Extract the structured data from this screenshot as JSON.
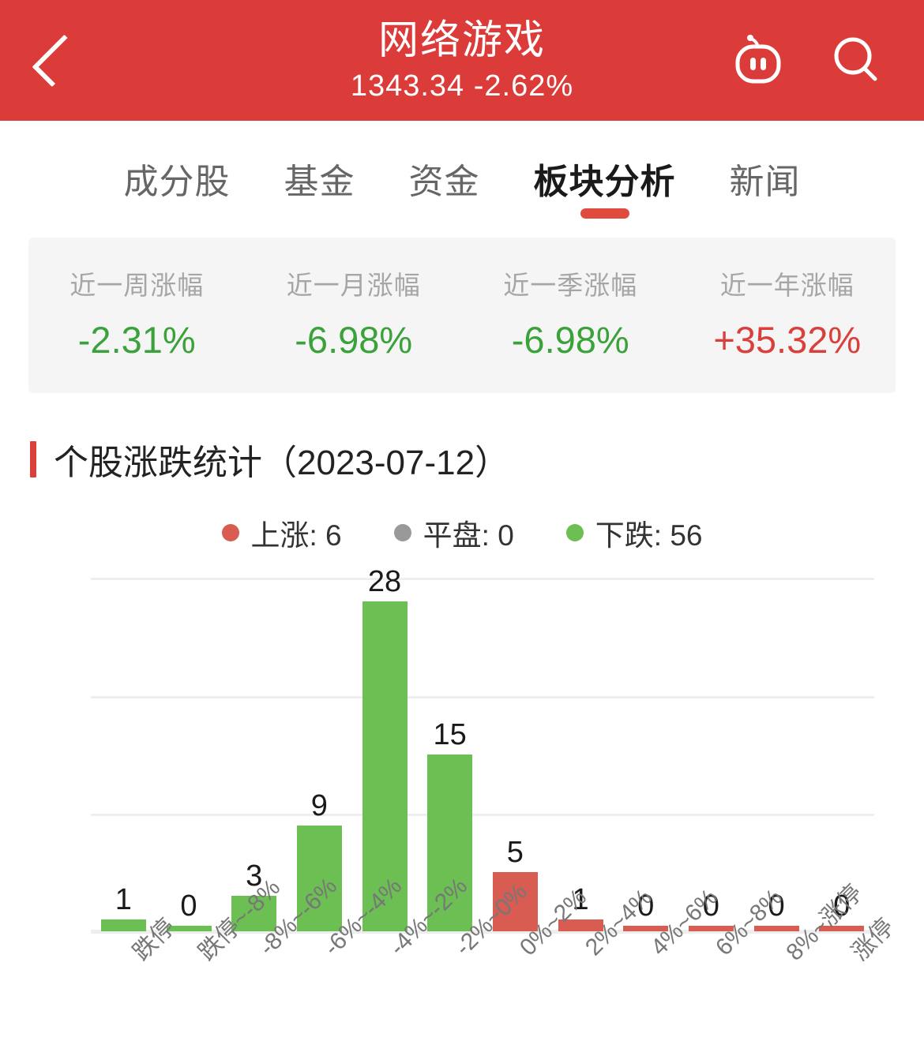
{
  "header": {
    "back_icon": "chevron-left-icon",
    "title": "网络游戏",
    "subtitle": "1343.34 -2.62%",
    "robot_icon": "robot-icon",
    "search_icon": "search-icon",
    "bg_color": "#dc3c39"
  },
  "tabs": [
    {
      "label": "成分股",
      "active": false
    },
    {
      "label": "基金",
      "active": false
    },
    {
      "label": "资金",
      "active": false
    },
    {
      "label": "板块分析",
      "active": true
    },
    {
      "label": "新闻",
      "active": false
    }
  ],
  "tab_indicator_color": "#e14b3d",
  "stats": [
    {
      "label": "近一周涨幅",
      "value": "-2.31%",
      "direction": "down"
    },
    {
      "label": "近一月涨幅",
      "value": "-6.98%",
      "direction": "down"
    },
    {
      "label": "近一季涨幅",
      "value": "-6.98%",
      "direction": "down"
    },
    {
      "label": "近一年涨幅",
      "value": "+35.32%",
      "direction": "up"
    }
  ],
  "section": {
    "title": "个股涨跌统计（2023-07-12）",
    "accent_color": "#d9403c"
  },
  "legend": [
    {
      "label": "上涨: 6",
      "color": "#d85c52"
    },
    {
      "label": "平盘: 0",
      "color": "#999999"
    },
    {
      "label": "下跌: 56",
      "color": "#6cbf52"
    }
  ],
  "chart_data": {
    "type": "bar",
    "title": "个股涨跌统计（2023-07-12）",
    "xlabel": "",
    "ylabel": "",
    "ylim": [
      0,
      31.5
    ],
    "yticks": [
      0,
      10,
      20,
      30
    ],
    "grid": true,
    "legend_position": "top-center",
    "categories": [
      "跌停",
      "跌停~-8%",
      "-8%~-6%",
      "-6%~-4%",
      "-4%~-2%",
      "-2%~0%",
      "0%~2%",
      "2%~4%",
      "4%~6%",
      "6%~8%",
      "8%~涨停",
      "涨停"
    ],
    "values": [
      1,
      0,
      3,
      9,
      28,
      15,
      5,
      1,
      0,
      0,
      0,
      0
    ],
    "colors": [
      "#6cbf52",
      "#6cbf52",
      "#6cbf52",
      "#6cbf52",
      "#6cbf52",
      "#6cbf52",
      "#d85c52",
      "#d85c52",
      "#d85c52",
      "#d85c52",
      "#d85c52",
      "#d85c52"
    ],
    "data_labels": [
      "1",
      "0",
      "3",
      "9",
      "28",
      "15",
      "5",
      "1",
      "0",
      "0",
      "0",
      "0"
    ]
  }
}
